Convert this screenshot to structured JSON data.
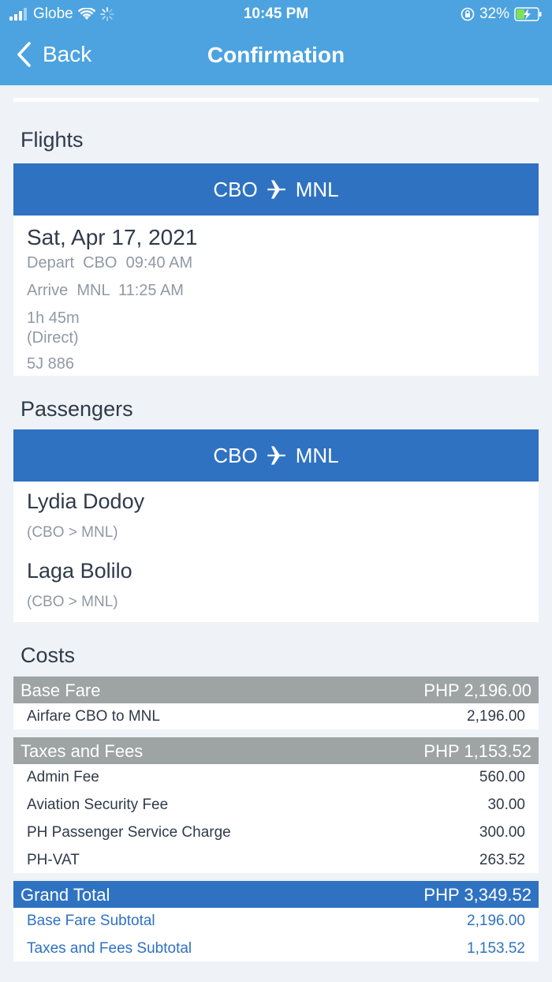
{
  "status": {
    "carrier": "Globe",
    "time": "10:45 PM",
    "battery": "32%"
  },
  "nav": {
    "back_label": "Back",
    "title": "Confirmation"
  },
  "flights": {
    "section_title": "Flights",
    "route_from": "CBO",
    "route_to": "MNL",
    "date": "Sat, Apr 17, 2021",
    "depart": "Depart  CBO  09:40 AM",
    "arrive": "Arrive  MNL  11:25 AM",
    "duration": "1h 45m",
    "type": "(Direct)",
    "flight_no": "5J 886"
  },
  "passengers": {
    "section_title": "Passengers",
    "route_from": "CBO",
    "route_to": "MNL",
    "list": [
      {
        "name": "Lydia Dodoy",
        "route": "(CBO > MNL)"
      },
      {
        "name": "Laga Bolilo",
        "route": "(CBO > MNL)"
      }
    ]
  },
  "costs": {
    "section_title": "Costs",
    "base_fare": {
      "label": "Base Fare",
      "amount": "PHP 2,196.00",
      "items": [
        {
          "label": "Airfare CBO to MNL",
          "amount": "2,196.00"
        }
      ]
    },
    "taxes": {
      "label": "Taxes and Fees",
      "amount": "PHP 1,153.52",
      "items": [
        {
          "label": "Admin Fee",
          "amount": "560.00"
        },
        {
          "label": "Aviation Security Fee",
          "amount": "30.00"
        },
        {
          "label": "PH Passenger Service Charge",
          "amount": "300.00"
        },
        {
          "label": "PH-VAT",
          "amount": "263.52"
        }
      ]
    },
    "grand_total": {
      "label": "Grand Total",
      "amount": "PHP 3,349.52",
      "items": [
        {
          "label": "Base Fare Subtotal",
          "amount": "2,196.00"
        },
        {
          "label": "Taxes and Fees Subtotal",
          "amount": "1,153.52"
        }
      ]
    }
  },
  "colors": {
    "header": "#4ca3e0",
    "route_bar": "#2f72c2",
    "cost_header_gray": "#9ea3a4",
    "background": "#eff2f6"
  }
}
